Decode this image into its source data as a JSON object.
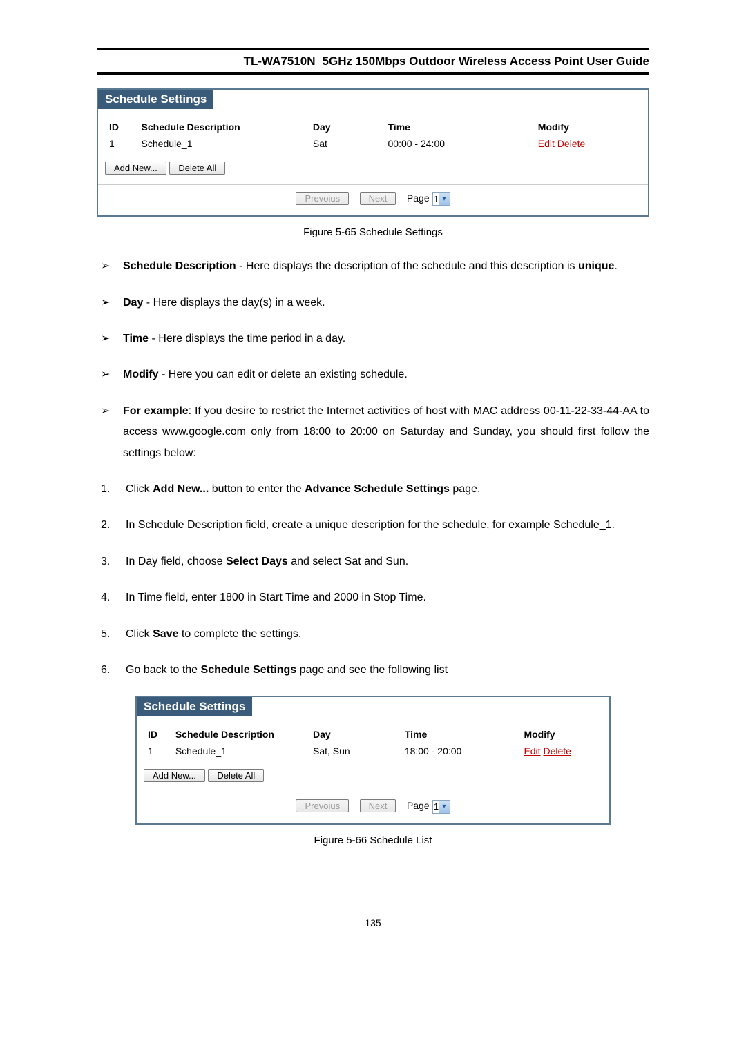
{
  "header": {
    "model": "TL-WA7510N",
    "title": "5GHz 150Mbps Outdoor Wireless Access Point User Guide"
  },
  "figure1": {
    "panel_title": "Schedule Settings",
    "cols": {
      "id": "ID",
      "desc": "Schedule Description",
      "day": "Day",
      "time": "Time",
      "modify": "Modify"
    },
    "rows": [
      {
        "id": "1",
        "desc": "Schedule_1",
        "day": "Sat",
        "time": "00:00 - 24:00",
        "edit": "Edit",
        "delete": "Delete"
      }
    ],
    "buttons": {
      "add": "Add New...",
      "delete_all": "Delete All",
      "prev": "Prevoius",
      "next": "Next",
      "page_label": "Page",
      "page_value": "1"
    },
    "caption": "Figure 5-65 Schedule Settings"
  },
  "bullets": [
    {
      "label": "Schedule Description",
      "text_before": " - Here displays the description of the schedule and this description is ",
      "bold_tail": "unique",
      "text_after": "."
    },
    {
      "label": "Day",
      "text_before": " - Here displays the day(s) in a week.",
      "bold_tail": "",
      "text_after": ""
    },
    {
      "label": "Time",
      "text_before": " - Here displays the time period in a day.",
      "bold_tail": "",
      "text_after": ""
    },
    {
      "label": "Modify",
      "text_before": " - Here you can edit or delete an existing schedule.",
      "bold_tail": "",
      "text_after": ""
    }
  ],
  "example": {
    "label": "For example",
    "text": ": If you desire to restrict the Internet activities of host with MAC address 00-11-22-33-44-AA to access www.google.com only from 18:00 to 20:00 on Saturday and Sunday, you should first follow the settings below:"
  },
  "steps": [
    {
      "n": "1.",
      "parts": [
        "Click ",
        "Add New...",
        " button to enter the ",
        "Advance Schedule Settings",
        " page."
      ]
    },
    {
      "n": "2.",
      "parts": [
        "In Schedule Description field, create a unique description for the schedule, for example Schedule_1."
      ]
    },
    {
      "n": "3.",
      "parts": [
        "In Day field, choose ",
        "Select Days",
        " and select Sat and Sun."
      ]
    },
    {
      "n": "4.",
      "parts": [
        "In Time field, enter 1800 in Start Time and 2000 in Stop Time."
      ]
    },
    {
      "n": "5.",
      "parts": [
        "Click ",
        "Save",
        " to complete the settings."
      ]
    },
    {
      "n": "6.",
      "parts": [
        "Go back to the ",
        "Schedule Settings",
        " page and see the following list"
      ]
    }
  ],
  "figure2": {
    "panel_title": "Schedule Settings",
    "cols": {
      "id": "ID",
      "desc": "Schedule Description",
      "day": "Day",
      "time": "Time",
      "modify": "Modify"
    },
    "rows": [
      {
        "id": "1",
        "desc": "Schedule_1",
        "day": "Sat, Sun",
        "time": "18:00 - 20:00",
        "edit": "Edit",
        "delete": "Delete"
      }
    ],
    "buttons": {
      "add": "Add New...",
      "delete_all": "Delete All",
      "prev": "Prevoius",
      "next": "Next",
      "page_label": "Page",
      "page_value": "1"
    },
    "caption": "Figure 5-66 Schedule List"
  },
  "page_number": "135"
}
